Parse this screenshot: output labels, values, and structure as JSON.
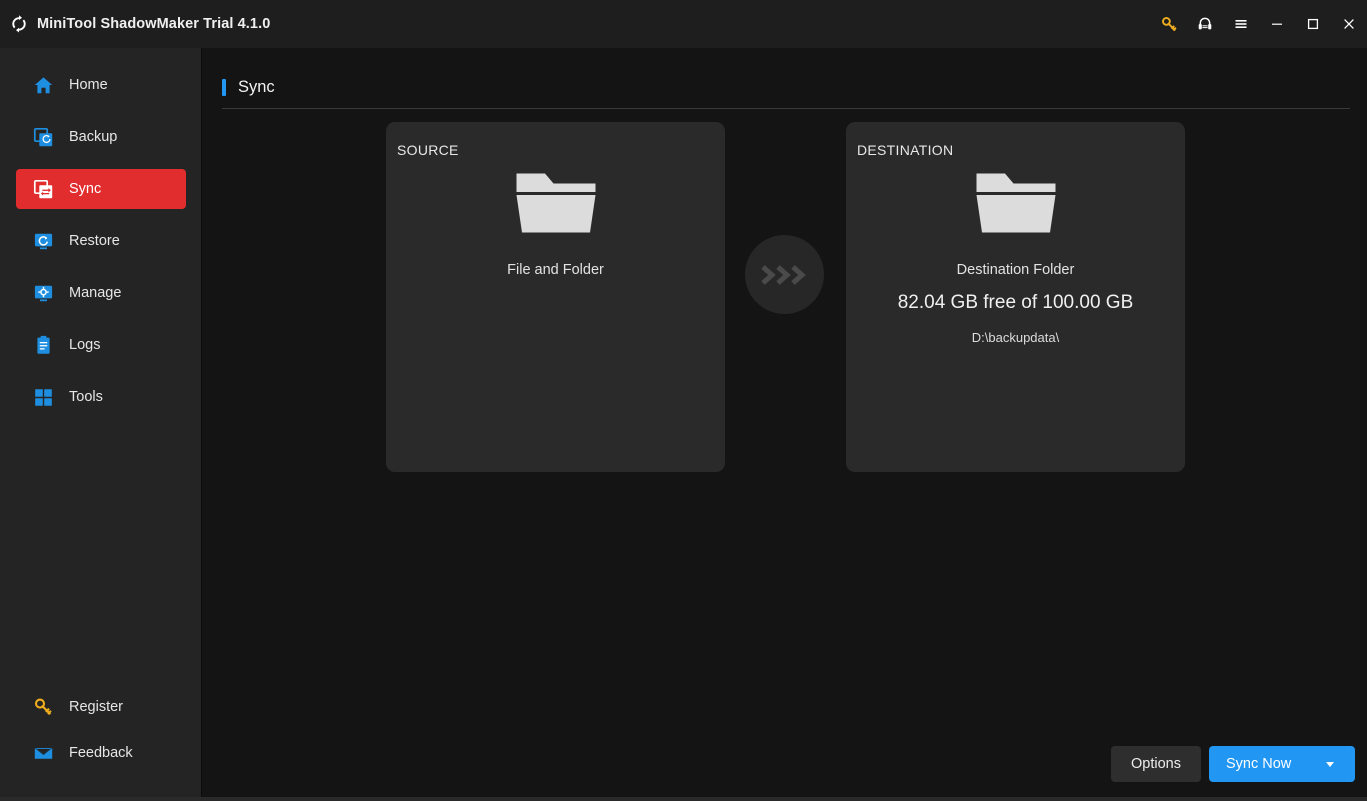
{
  "window": {
    "title": "MiniTool ShadowMaker Trial 4.1.0",
    "logo_icon": "sync-circular-arrows-icon",
    "controls": [
      {
        "name": "register-key-button",
        "icon": "key-icon",
        "color": "#f0ad1e"
      },
      {
        "name": "support-button",
        "icon": "headset-icon",
        "color": "#ffffff"
      },
      {
        "name": "menu-button",
        "icon": "hamburger-menu-icon",
        "color": "#ffffff"
      },
      {
        "name": "minimize-button",
        "icon": "minimize-icon",
        "color": "#ffffff"
      },
      {
        "name": "maximize-button",
        "icon": "maximize-icon",
        "color": "#ffffff"
      },
      {
        "name": "close-button",
        "icon": "close-icon",
        "color": "#ffffff"
      }
    ]
  },
  "sidebar": {
    "items": [
      {
        "label": "Home",
        "icon": "home-icon",
        "active": false
      },
      {
        "label": "Backup",
        "icon": "backup-icon",
        "active": false
      },
      {
        "label": "Sync",
        "icon": "sync-icon",
        "active": true
      },
      {
        "label": "Restore",
        "icon": "restore-icon",
        "active": false
      },
      {
        "label": "Manage",
        "icon": "manage-icon",
        "active": false
      },
      {
        "label": "Logs",
        "icon": "logs-icon",
        "active": false
      },
      {
        "label": "Tools",
        "icon": "tools-icon",
        "active": false
      }
    ],
    "bottom_items": [
      {
        "label": "Register",
        "icon": "key-icon"
      },
      {
        "label": "Feedback",
        "icon": "envelope-icon"
      }
    ],
    "active_color": "#e12d2d",
    "icon_color": "#1e8fe0",
    "register_icon_color": "#f0ad1e"
  },
  "page": {
    "title": "Sync",
    "accent_color": "#2196f3"
  },
  "source_panel": {
    "heading": "SOURCE",
    "icon": "folder-icon",
    "label": "File and Folder"
  },
  "destination_panel": {
    "heading": "DESTINATION",
    "icon": "folder-icon",
    "label": "Destination Folder",
    "capacity": "82.04 GB free of 100.00 GB",
    "path": "D:\\backupdata\\"
  },
  "connector": {
    "icon": "triple-chevron-right-icon"
  },
  "footer": {
    "options_label": "Options",
    "sync_now_label": "Sync Now",
    "sync_dropdown_icon": "chevron-down-icon",
    "primary_color": "#2196f3"
  }
}
